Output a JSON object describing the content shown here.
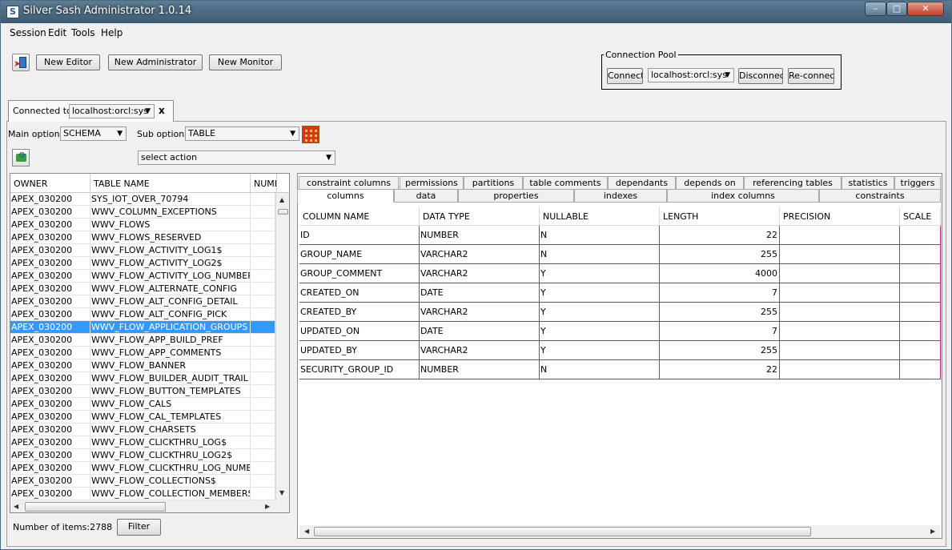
{
  "window": {
    "title": "Silver Sash Administrator 1.0.14"
  },
  "menu": [
    "Session",
    "Edit",
    "Tools",
    "Help"
  ],
  "toolbar": {
    "new_editor": "New Editor",
    "new_administrator": "New Administrator",
    "new_monitor": "New Monitor"
  },
  "connection_pool": {
    "legend": "Connection Pool",
    "connect": "Connect",
    "selected": "localhost:orcl:sys",
    "disconnect": "Disconnect",
    "reconnect": "Re-connect"
  },
  "connected_tab": {
    "label": "Connected to:",
    "value": "localhost:orcl:sys",
    "close": "x"
  },
  "options": {
    "main_label": "Main options:",
    "main_value": "SCHEMA",
    "sub_label": "Sub options:",
    "sub_value": "TABLE",
    "action_value": "select action"
  },
  "left_table": {
    "headers": [
      "OWNER",
      "TABLE NAME",
      "NUMB"
    ],
    "rows": [
      [
        "APEX_030200",
        "SYS_IOT_OVER_70794"
      ],
      [
        "APEX_030200",
        "WWV_COLUMN_EXCEPTIONS"
      ],
      [
        "APEX_030200",
        "WWV_FLOWS"
      ],
      [
        "APEX_030200",
        "WWV_FLOWS_RESERVED"
      ],
      [
        "APEX_030200",
        "WWV_FLOW_ACTIVITY_LOG1$"
      ],
      [
        "APEX_030200",
        "WWV_FLOW_ACTIVITY_LOG2$"
      ],
      [
        "APEX_030200",
        "WWV_FLOW_ACTIVITY_LOG_NUMBER$"
      ],
      [
        "APEX_030200",
        "WWV_FLOW_ALTERNATE_CONFIG"
      ],
      [
        "APEX_030200",
        "WWV_FLOW_ALT_CONFIG_DETAIL"
      ],
      [
        "APEX_030200",
        "WWV_FLOW_ALT_CONFIG_PICK"
      ],
      [
        "APEX_030200",
        "WWV_FLOW_APPLICATION_GROUPS"
      ],
      [
        "APEX_030200",
        "WWV_FLOW_APP_BUILD_PREF"
      ],
      [
        "APEX_030200",
        "WWV_FLOW_APP_COMMENTS"
      ],
      [
        "APEX_030200",
        "WWV_FLOW_BANNER"
      ],
      [
        "APEX_030200",
        "WWV_FLOW_BUILDER_AUDIT_TRAIL"
      ],
      [
        "APEX_030200",
        "WWV_FLOW_BUTTON_TEMPLATES"
      ],
      [
        "APEX_030200",
        "WWV_FLOW_CALS"
      ],
      [
        "APEX_030200",
        "WWV_FLOW_CAL_TEMPLATES"
      ],
      [
        "APEX_030200",
        "WWV_FLOW_CHARSETS"
      ],
      [
        "APEX_030200",
        "WWV_FLOW_CLICKTHRU_LOG$"
      ],
      [
        "APEX_030200",
        "WWV_FLOW_CLICKTHRU_LOG2$"
      ],
      [
        "APEX_030200",
        "WWV_FLOW_CLICKTHRU_LOG_NUMB..."
      ],
      [
        "APEX_030200",
        "WWV_FLOW_COLLECTIONS$"
      ],
      [
        "APEX_030200",
        "WWV_FLOW_COLLECTION_MEMBERS$"
      ]
    ],
    "selected_index": 10
  },
  "footer": {
    "count_label": "Number of items:2788",
    "filter": "Filter"
  },
  "tabs_top": [
    "constraint columns",
    "permissions",
    "partitions",
    "table comments",
    "dependants",
    "depends on",
    "referencing tables",
    "statistics",
    "triggers"
  ],
  "tabs_bottom": [
    "columns",
    "data",
    "properties",
    "indexes",
    "index columns",
    "constraints"
  ],
  "columns_table": {
    "headers": [
      "COLUMN NAME",
      "DATA TYPE",
      "NULLABLE",
      "LENGTH",
      "PRECISION",
      "SCALE"
    ],
    "rows": [
      [
        "ID",
        "NUMBER",
        "N",
        "22",
        "",
        ""
      ],
      [
        "GROUP_NAME",
        "VARCHAR2",
        "N",
        "255",
        "",
        ""
      ],
      [
        "GROUP_COMMENT",
        "VARCHAR2",
        "Y",
        "4000",
        "",
        ""
      ],
      [
        "CREATED_ON",
        "DATE",
        "Y",
        "7",
        "",
        ""
      ],
      [
        "CREATED_BY",
        "VARCHAR2",
        "Y",
        "255",
        "",
        ""
      ],
      [
        "UPDATED_ON",
        "DATE",
        "Y",
        "7",
        "",
        ""
      ],
      [
        "UPDATED_BY",
        "VARCHAR2",
        "Y",
        "255",
        "",
        ""
      ],
      [
        "SECURITY_GROUP_ID",
        "NUMBER",
        "N",
        "22",
        "",
        ""
      ]
    ]
  },
  "colors": {
    "selection": "#3399ff",
    "grid_line": "#c8287a"
  }
}
